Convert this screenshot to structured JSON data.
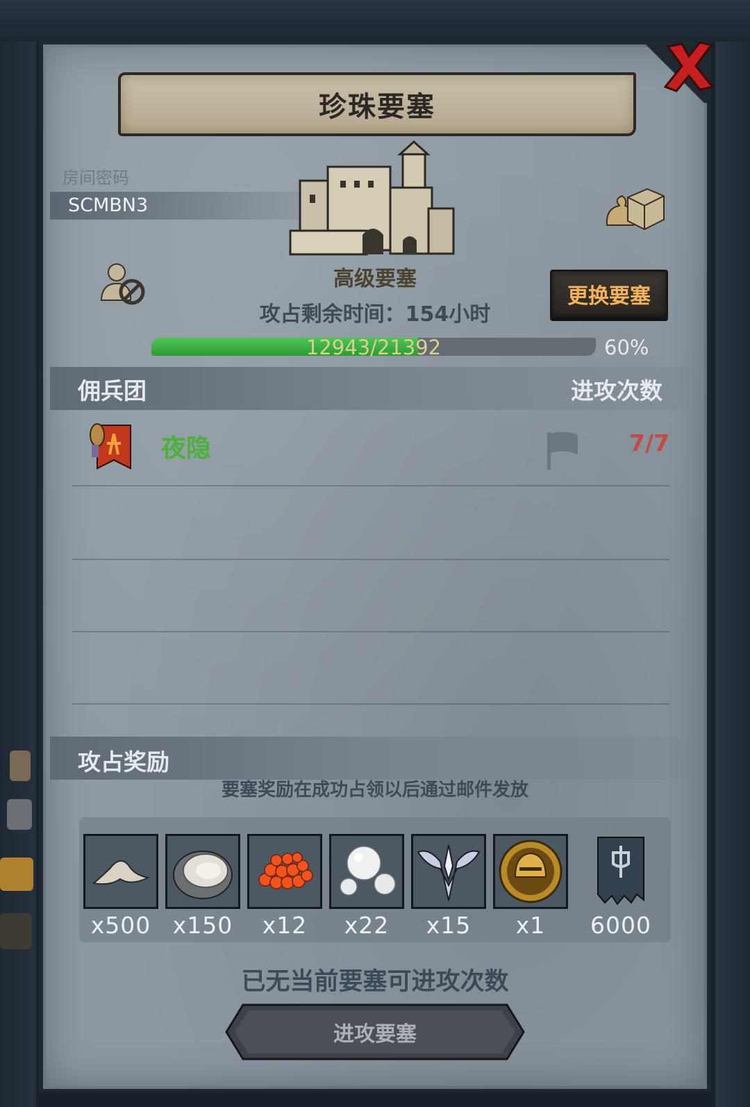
{
  "title": "珍珠要塞",
  "room": {
    "label": "房间密码",
    "code": "SCMBN3"
  },
  "fortress": {
    "type": "高级要塞",
    "time_remaining": "攻占剩余时间：154小时",
    "change_button": "更换要塞",
    "progress": {
      "text": "12943/21392",
      "percent_text": "60%",
      "fraction": 0.6
    }
  },
  "mercenary_section": {
    "title": "佣兵团",
    "attack_count_header": "进攻次数",
    "rows": [
      {
        "name": "夜隐",
        "attacks": "7/7"
      }
    ]
  },
  "rewards": {
    "title": "攻占奖励",
    "note": "要塞奖励在成功占领以后通过邮件发放",
    "items": [
      {
        "icon": "sand-pile-icon",
        "qty": "x500"
      },
      {
        "icon": "oyster-icon",
        "qty": "x150"
      },
      {
        "icon": "fish-roe-icon",
        "qty": "x12"
      },
      {
        "icon": "pearl-icon",
        "qty": "x22"
      },
      {
        "icon": "silver-wings-emblem-icon",
        "qty": "x15"
      },
      {
        "icon": "golden-helmet-coin-icon",
        "qty": "x1"
      },
      {
        "icon": "guild-banner-icon",
        "qty": "6000"
      }
    ]
  },
  "status_message": "已无当前要塞可进攻次数",
  "attack_button": "进攻要塞",
  "colors": {
    "progress_fill": "#3fb548",
    "merc_name": "#4bb13a",
    "attack_count": "#c44a48",
    "change_button_text": "#f3b35a",
    "close_x": "#d42020"
  }
}
